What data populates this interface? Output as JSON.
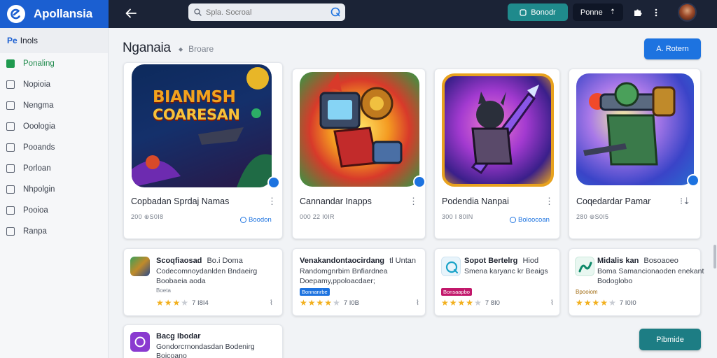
{
  "app": {
    "name": "Apollansia"
  },
  "topbar": {
    "search_placeholder": "Spla. Socroal",
    "teal_button": "Bonodr",
    "dark_button": "Ponne",
    "dark_button_glyph": "⇡"
  },
  "sidebar": {
    "header_tag": "Pe",
    "header_label": "Inols",
    "items": [
      {
        "label": "Ponaling",
        "active": true
      },
      {
        "label": "Nopioia"
      },
      {
        "label": "Nengma"
      },
      {
        "label": "Ooologia"
      },
      {
        "label": "Pooands"
      },
      {
        "label": "Porloan"
      },
      {
        "label": "Nhpolgin"
      },
      {
        "label": "Pooioa"
      },
      {
        "label": "Ranpa"
      }
    ]
  },
  "main": {
    "title": "Nganaia",
    "breadcrumb": "Broare",
    "action_button": "A. Rotern",
    "bottom_button": "Pibmide"
  },
  "featured": [
    {
      "art_text_1": "BIANMSH",
      "art_text_2": "COARESAN",
      "title": "Copbadan Sprdaj Namas",
      "sub": "200 ⊕S0I8",
      "link": "Boodon"
    },
    {
      "title": "Cannandar Inapps",
      "sub": "000 22 I0IR"
    },
    {
      "title": "Podendia Nanpai",
      "sub": "300 I 80IN",
      "link": "Boloocoan"
    },
    {
      "title": "Coqedardar Pamar",
      "sub": "280 ⊕S0I5"
    }
  ],
  "list": [
    {
      "title": "Scoqfiaosad",
      "title_extra": "Bo.i Doma",
      "line1": "Codecomnoydanlden Bndaeirg",
      "line2": "Boobaeia aoda",
      "small": "Boeta",
      "count": "7 I8I4",
      "stars": 3
    },
    {
      "title": "Venakandontaocirdang",
      "title_extra": "tl Untan",
      "line1": "Randomgnrbim Bnfiardnea",
      "line2": "Doepamy,ppoloacdaer;",
      "tag": "Bonnanrbe",
      "count": "7 I0B",
      "stars": 4
    },
    {
      "title": "Sopot Bertelrg",
      "title_extra": "Hiod",
      "line1": "Smena karyanc kr Beaigs",
      "tag": "Bonsaapbo",
      "count": "7 8I0",
      "stars": 4
    },
    {
      "title": "Midalis kan",
      "title_extra": "Bosoaoeo",
      "line1": "Boma Samancionaoden enekant",
      "line2": "Bodoglobo",
      "small": "Bpooiom",
      "count": "7 I0I0",
      "stars": 4
    },
    {
      "title": "Bacg Ibodar",
      "line1": "Gondorcrnondasdan Bodenirg",
      "line2": "Boicoano"
    }
  ]
}
